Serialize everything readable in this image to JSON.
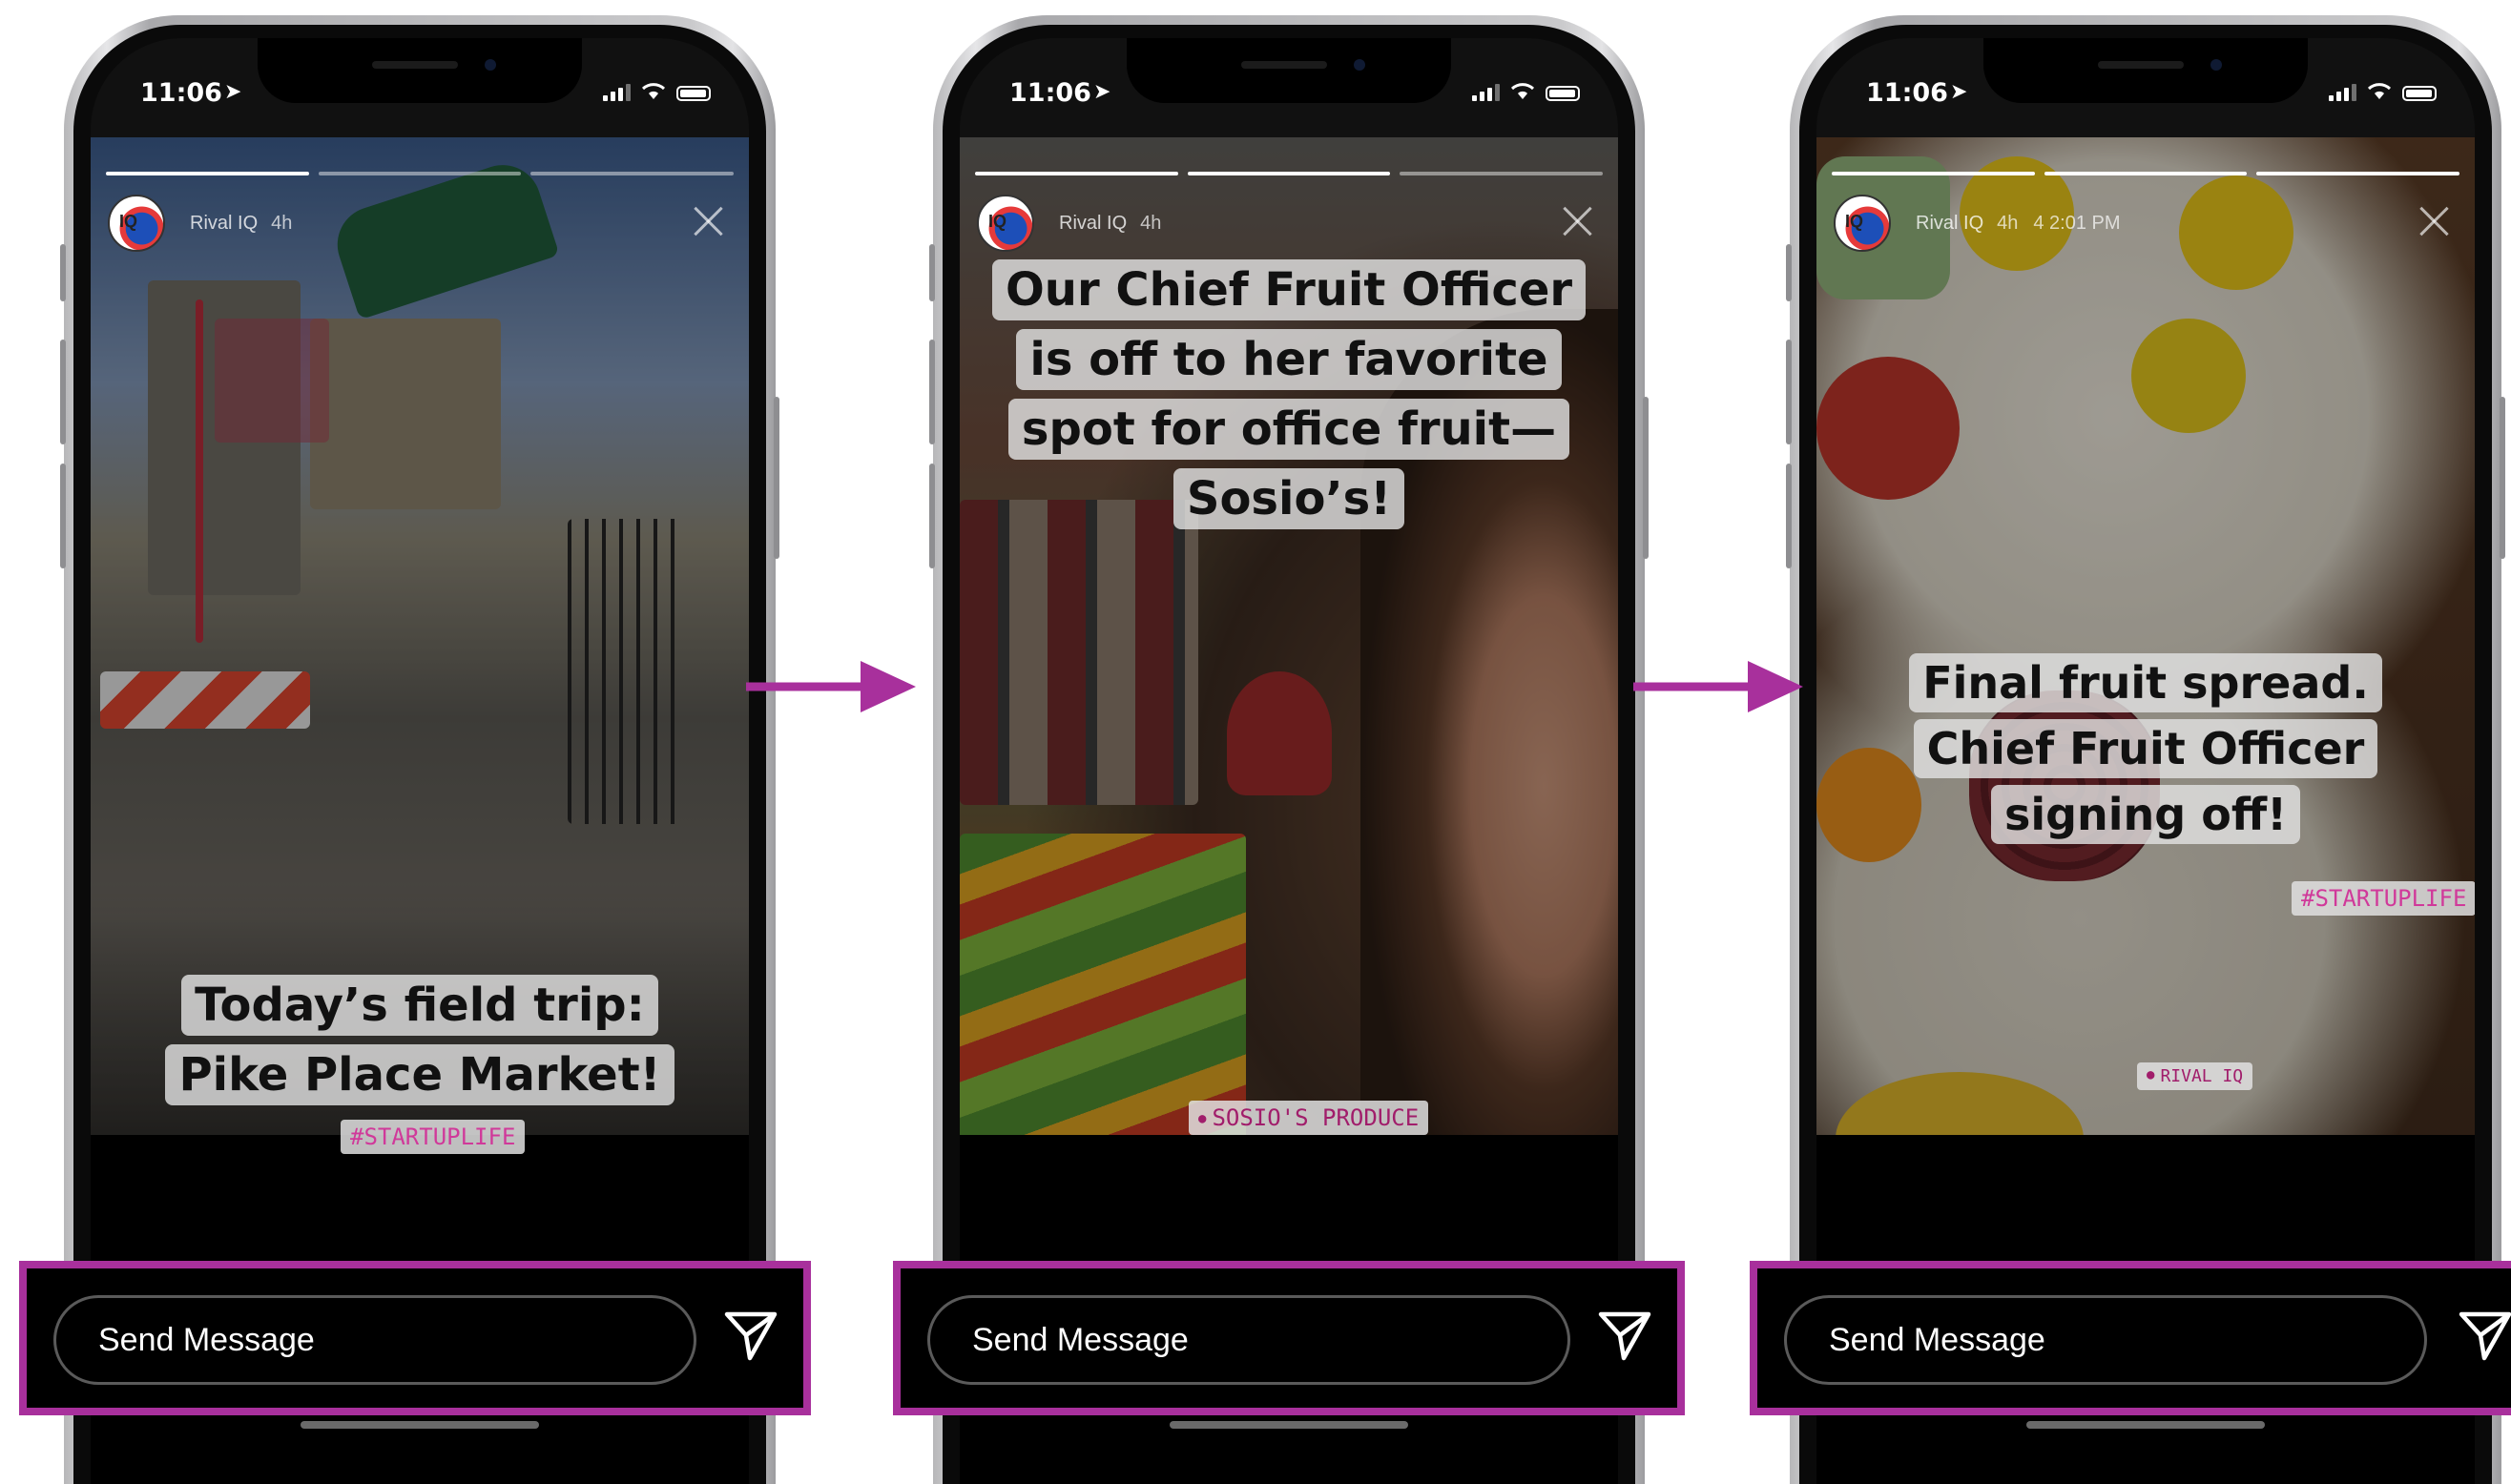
{
  "status_bar": {
    "time": "11:06"
  },
  "composer": {
    "placeholder": "Send Message"
  },
  "colors": {
    "highlight": "#a8309c",
    "arrow": "#a8309c",
    "tag_text": "#d0399a"
  },
  "stories": [
    {
      "user": "Rival IQ",
      "age": "4h",
      "caption": "Today’s field trip: Pike Place Market!",
      "hashtag": "#STARTUPLIFE",
      "progress": {
        "segments": 3,
        "current": 1
      }
    },
    {
      "user": "Rival IQ",
      "age": "4h",
      "caption": "Our Chief Fruit Officer is off to her favorite spot for office fruit—Sosio’s!",
      "location": "SOSIO'S PRODUCE",
      "progress": {
        "segments": 3,
        "current": 2
      }
    },
    {
      "user": "Rival IQ",
      "age": "4h",
      "timestamp": "4 2:01 PM",
      "caption": "Final fruit spread. Chief Fruit Officer signing off!",
      "hashtag": "#STARTUPLIFE",
      "location": "RIVAL IQ",
      "progress": {
        "segments": 3,
        "current": 3
      }
    }
  ]
}
